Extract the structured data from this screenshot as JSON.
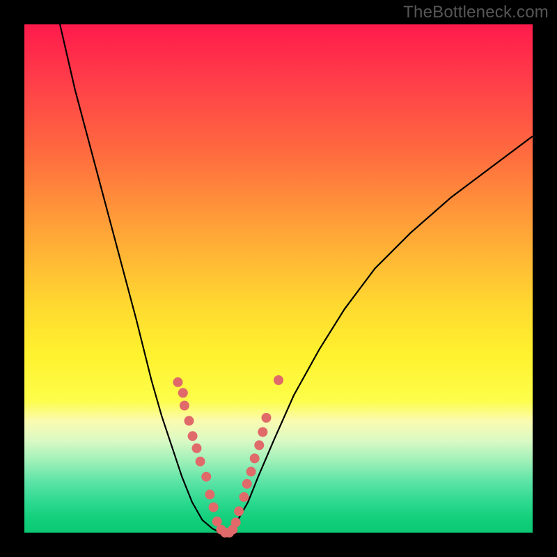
{
  "watermark": {
    "text": "TheBottleneck.com"
  },
  "chart_data": {
    "type": "line",
    "title": "",
    "xlabel": "",
    "ylabel": "",
    "xlim": [
      0,
      100
    ],
    "ylim": [
      0,
      100
    ],
    "series": [
      {
        "name": "bottleneck-curve",
        "x": [
          7,
          10,
          14,
          18,
          22,
          25,
          27,
          29,
          31,
          33,
          35,
          37,
          38.5,
          40,
          42,
          44,
          46,
          49,
          53,
          58,
          63,
          69,
          76,
          84,
          92,
          100
        ],
        "y": [
          100,
          87,
          72,
          57,
          42,
          30,
          23,
          17,
          11,
          6,
          2.5,
          0.8,
          0,
          0.6,
          2.5,
          6,
          11,
          18,
          27,
          36,
          44,
          52,
          59,
          66,
          72,
          78
        ]
      }
    ],
    "scatter_points": {
      "name": "highlight-points",
      "color": "#e06a6a",
      "x": [
        30.2,
        31.2,
        31.5,
        32.4,
        33.1,
        33.9,
        34.6,
        35.8,
        36.5,
        37.2,
        37.9,
        38.7,
        39.5,
        40.3,
        41.0,
        41.6,
        42.2,
        43.2,
        43.8,
        44.6,
        45.3,
        46.2,
        46.9,
        47.6,
        50.0
      ],
      "y": [
        29.6,
        27.5,
        25.0,
        22.0,
        19.0,
        16.6,
        14.0,
        11.0,
        7.5,
        5.0,
        2.2,
        0.6,
        0.0,
        0.0,
        0.6,
        2.0,
        4.2,
        7.0,
        9.6,
        12.0,
        14.6,
        17.2,
        19.8,
        22.6,
        30.0
      ]
    },
    "annotations": []
  }
}
